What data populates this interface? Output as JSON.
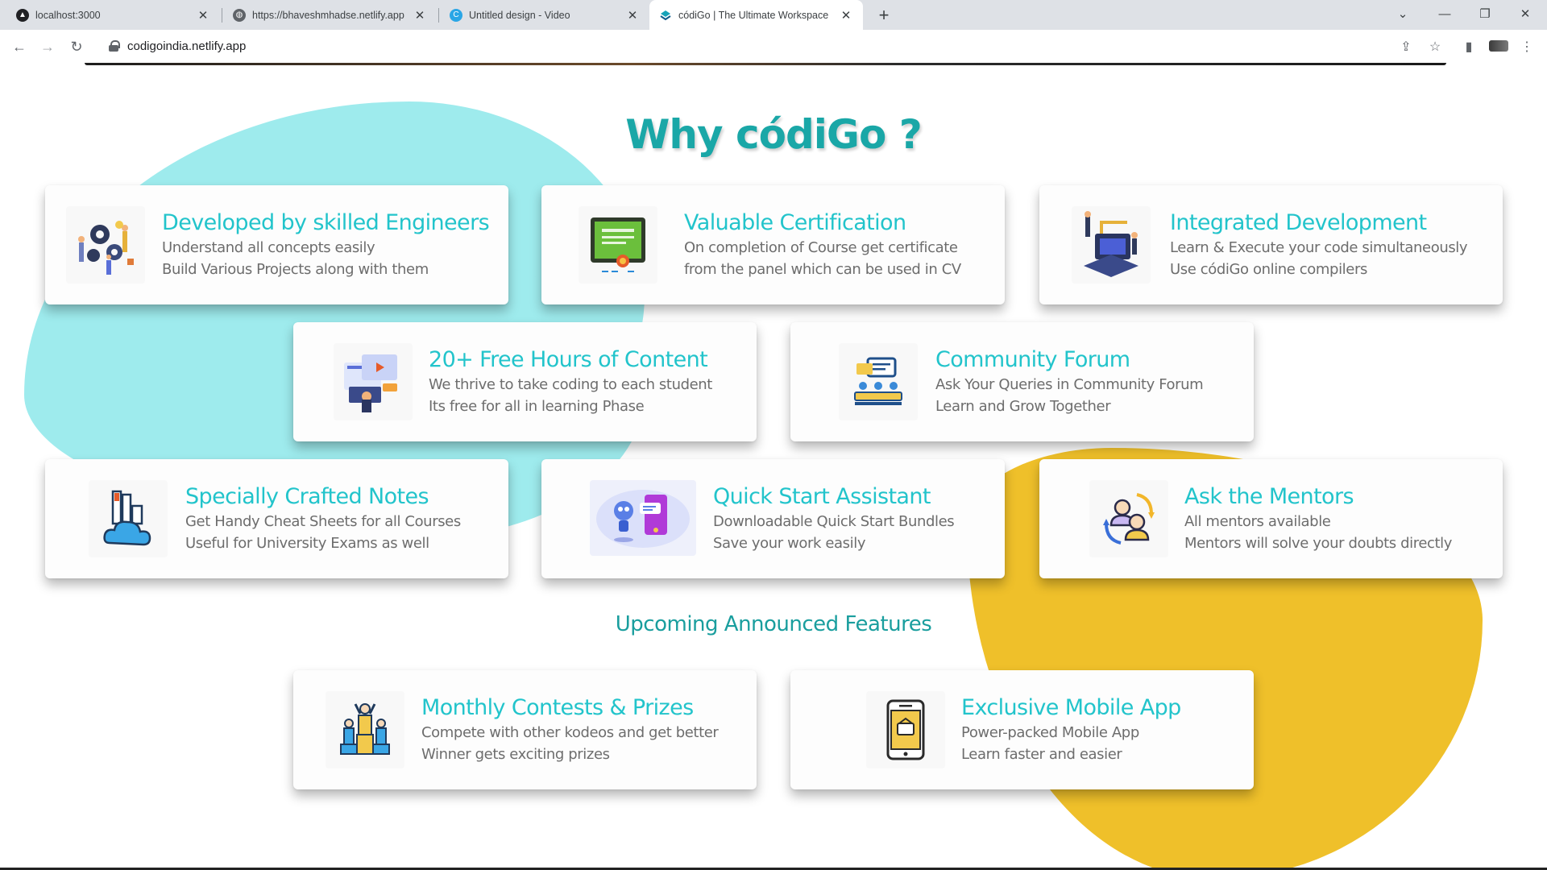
{
  "browser": {
    "tabs": [
      {
        "label": "localhost:3000",
        "icon": "localhost-favicon-icon"
      },
      {
        "label": "https://bhaveshmhadse.netlify.app",
        "icon": "globe-icon"
      },
      {
        "label": "Untitled design - Video",
        "icon": "canva-icon"
      },
      {
        "label": "códiGo | The Ultimate Workspace",
        "icon": "codigo-favicon-icon"
      }
    ],
    "active_tab": 3,
    "url": "codigoindia.netlify.app"
  },
  "page": {
    "heading": "Why códiGo ?",
    "upcoming_heading": "Upcoming Announced Features",
    "features": [
      {
        "title": "Developed by skilled Engineers",
        "line1": "Understand all concepts easily",
        "line2": "Build Various Projects along with them",
        "icon": "engineers-team-icon"
      },
      {
        "title": "Valuable Certification",
        "line1": "On completion of Course get certificate",
        "line2": "from the panel which can be used in CV",
        "icon": "certificate-icon"
      },
      {
        "title": "Integrated Development",
        "line1": "Learn & Execute your code simultaneously",
        "line2": "Use códiGo online compilers",
        "icon": "development-icon"
      },
      {
        "title": "20+ Free Hours of Content",
        "line1": "We thrive to take coding to each student",
        "line2": "Its free for all in learning Phase",
        "icon": "video-content-icon"
      },
      {
        "title": "Community Forum",
        "line1": "Ask Your Queries in Community Forum",
        "line2": "Learn and Grow Together",
        "icon": "community-forum-icon"
      },
      {
        "title": "Specially Crafted Notes",
        "line1": "Get Handy Cheat Sheets for all Courses",
        "line2": "Useful for University Exams as well",
        "icon": "notes-cloud-icon"
      },
      {
        "title": "Quick Start Assistant",
        "line1": "Downloadable Quick Start Bundles",
        "line2": "Save your work easily",
        "icon": "chatbot-assistant-icon"
      },
      {
        "title": "Ask the Mentors",
        "line1": "All mentors available",
        "line2": "Mentors will solve your doubts directly",
        "icon": "mentors-icon"
      }
    ],
    "upcoming": [
      {
        "title": "Monthly Contests & Prizes",
        "line1": "Compete with other kodeos and get better",
        "line2": "Winner gets exciting prizes",
        "icon": "trophy-winners-icon"
      },
      {
        "title": "Exclusive Mobile App",
        "line1": "Power-packed Mobile App",
        "line2": "Learn faster and easier",
        "icon": "mobile-app-icon"
      }
    ]
  },
  "colors": {
    "teal_heading": "#1aa7a7",
    "card_title": "#22c4cb",
    "blob_teal": "#9eebed",
    "blob_yellow": "#efc02a"
  }
}
